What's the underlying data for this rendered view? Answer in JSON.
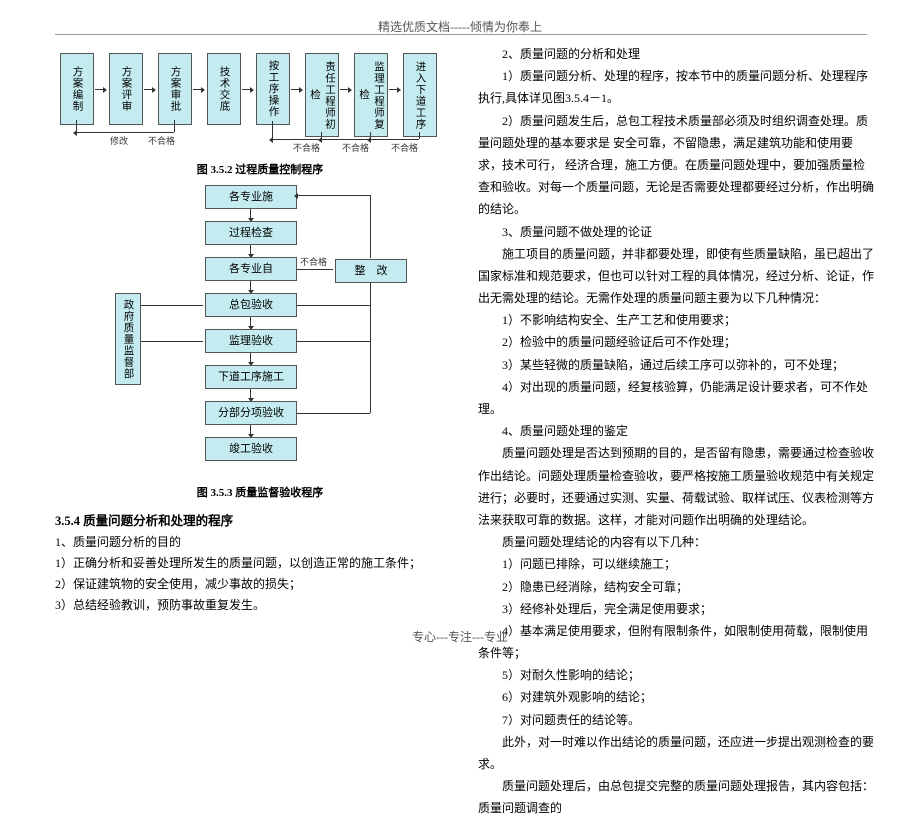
{
  "header": "精选优质文档-----倾情为你奉上",
  "footer": "专心---专注---专业",
  "fig352": {
    "caption": "图 3.5.2  过程质量控制程序",
    "boxes": [
      "方案编制",
      "方案评审",
      "方案审批",
      "技术交底",
      "按工序操作",
      "责任工程师初检",
      "监理工程师复检",
      "进入下道工序"
    ],
    "badLabel": "不合格",
    "modifyLabel": "修改"
  },
  "fig353": {
    "caption": "图 3.5.3  质量监督验收程序",
    "steps": [
      "各专业施",
      "过程检查",
      "各专业自",
      "总包验收",
      "监理验收",
      "下道工序施工",
      "分部分项验收",
      "竣工验收"
    ],
    "side": "政府质量监督部",
    "rework": "整　改",
    "badLabel": "不合格"
  },
  "left": {
    "secTitle": "3.5.4  质量问题分析和处理的程序",
    "p1": "1、质量问题分析的目的",
    "p1a": "1）正确分析和妥善处理所发生的质量问题，以创造正常的施工条件；",
    "p1b": "2）保证建筑物的安全使用，减少事故的损失；",
    "p1c": "3）总结经验教训，预防事故重复发生。"
  },
  "right": {
    "t1": "2、质量问题的分析和处理",
    "t1a": "1）质量问题分析、处理的程序，按本节中的质量问题分析、处理程序执行,具体详见图3.5.4－1。",
    "t1b": "2）质量问题发生后，总包工程技术质量部必须及时组织调查处理。质量问题处理的基本要求是 安全可靠，不留隐患，满足建筑功能和使用要求，技术可行， 经济合理，施工方便。在质量问题处理中，要加强质量检查和验收。对每一个质量问题，无论是否需要处理都要经过分析，作出明确的结论。",
    "t2": "3、质量问题不做处理的论证",
    "t2a": "施工项目的质量问题，并非都要处理，即使有些质量缺陷，虽已超出了国家标准和规范要求，但也可以针对工程的具体情况，经过分析、论证，作出无需处理的结论。无需作处理的质量问题主要为以下几种情况：",
    "t2a1": "1）不影响结构安全、生产工艺和使用要求；",
    "t2a2": "2）检验中的质量问题经验证后可不作处理；",
    "t2a3": "3）某些轻微的质量缺陷，通过后续工序可以弥补的，可不处理；",
    "t2a4": "4）对出现的质量问题，经复核验算，仍能满足设计要求者，可不作处理。",
    "t3": "4、质量问题处理的鉴定",
    "t3a": "质量问题处理是否达到预期的目的，是否留有隐患，需要通过检查验收作出结论。问题处理质量检查验收，要严格按施工质量验收规范中有关规定进行；必要时，还要通过实测、实量、荷载试验、取样试压、仪表检测等方法来获取可靠的数据。这样，才能对问题作出明确的处理结论。",
    "t3b": "质量问题处理结论的内容有以下几种：",
    "t3b1": "1）问题已排除，可以继续施工；",
    "t3b2": "2）隐患已经消除，结构安全可靠；",
    "t3b3": "3）经修补处理后，完全满足使用要求；",
    "t3b4": "4）基本满足使用要求，但附有限制条件，如限制使用荷载，限制使用条件等；",
    "t3b5": "5）对耐久性影响的结论；",
    "t3b6": "6）对建筑外观影响的结论；",
    "t3b7": "7）对问题责任的结论等。",
    "t3c": "此外，对一时难以作出结论的质量问题，还应进一步提出观测检查的要求。",
    "t3d": "质量问题处理后，由总包提交完整的质量问题处理报告，其内容包括：质量问题调查的"
  }
}
